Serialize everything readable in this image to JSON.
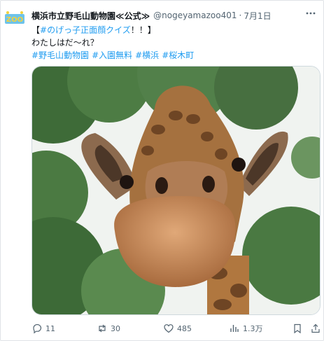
{
  "post": {
    "display_name": "横浜市立野毛山動物園≪公式≫",
    "handle": "@nogeyamazoo401",
    "separator": "·",
    "date": "7月1日",
    "avatar_text": "ZOO",
    "line1_prefix": "【",
    "line1_highlight": "#のげっ子正面顔クイズ",
    "line1_suffix": "！！】",
    "line2": "わたしはだ〜れ？",
    "hashtags": [
      "#野毛山動物園",
      "#入園無料",
      "#横浜",
      "#桜木町"
    ]
  },
  "actions": {
    "replies": "11",
    "reposts": "30",
    "likes": "485",
    "views": "1.3万"
  },
  "colors": {
    "link": "#1d9bf0",
    "muted": "#536471",
    "text": "#0f1419"
  },
  "icons": [
    "verified-logo",
    "more-icon",
    "reply-icon",
    "repost-icon",
    "like-icon",
    "views-icon",
    "bookmark-icon",
    "share-icon"
  ]
}
